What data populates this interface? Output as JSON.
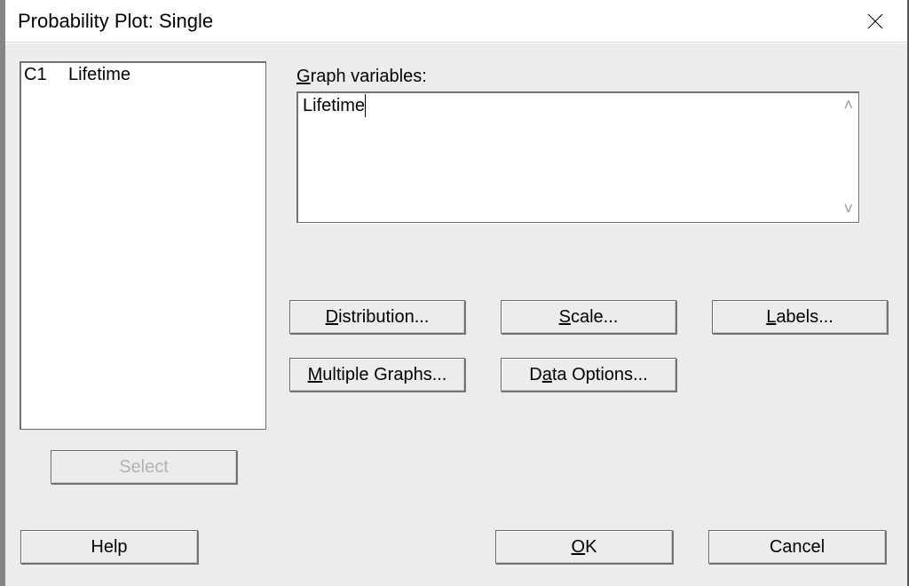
{
  "title": "Probability Plot: Single",
  "variables_list": [
    {
      "col": "C1",
      "name": "Lifetime"
    }
  ],
  "graph_variables_label": "Graph variables:",
  "graph_variables_label_prefix": "G",
  "graph_variables_input": "Lifetime",
  "buttons": {
    "distribution": "Distribution...",
    "distribution_u": "D",
    "scale": "Scale...",
    "scale_u": "S",
    "labels": "Labels...",
    "labels_u": "L",
    "multiple_graphs": "Multiple Graphs...",
    "multiple_graphs_u": "M",
    "data_options": "Data Options...",
    "data_options_u": "a",
    "select": "Select",
    "help": "Help",
    "ok": "OK",
    "ok_u": "O",
    "cancel": "Cancel"
  }
}
